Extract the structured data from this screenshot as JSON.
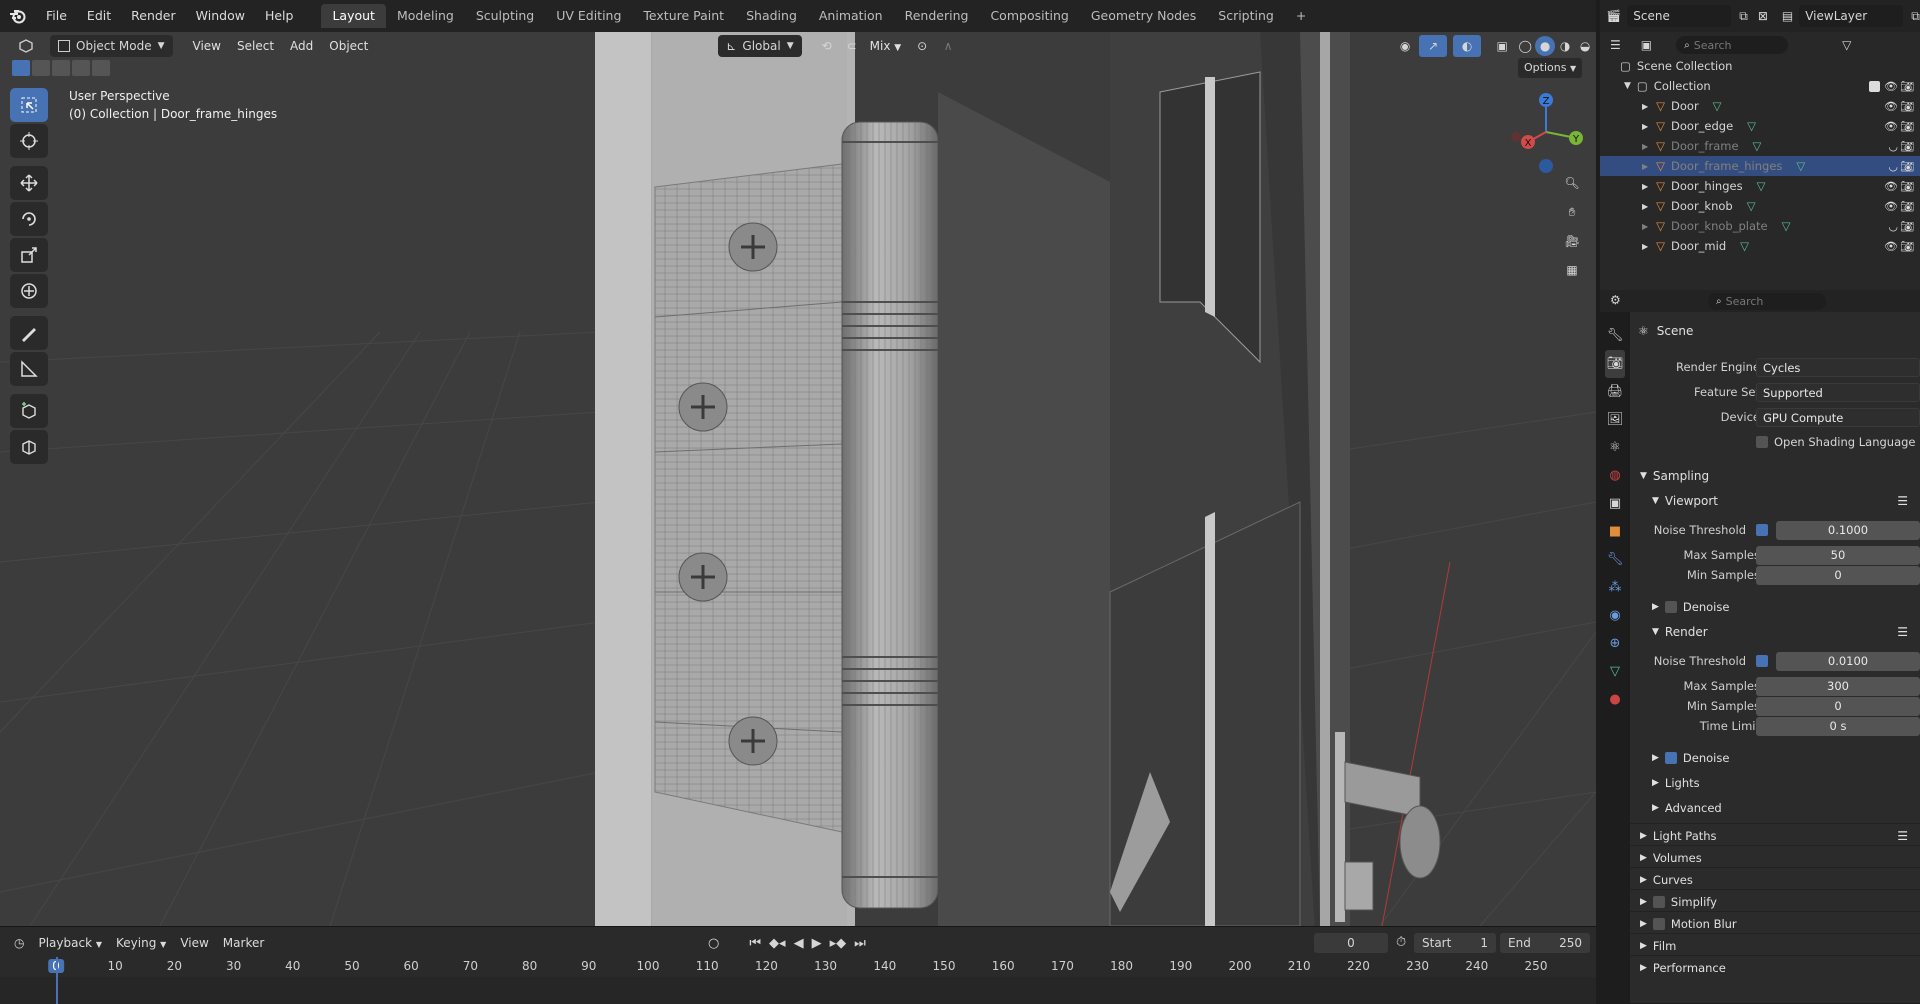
{
  "topbar": {
    "menus": [
      "File",
      "Edit",
      "Render",
      "Window",
      "Help"
    ],
    "workspaces": [
      "Layout",
      "Modeling",
      "Sculpting",
      "UV Editing",
      "Texture Paint",
      "Shading",
      "Animation",
      "Rendering",
      "Compositing",
      "Geometry Nodes",
      "Scripting",
      "+"
    ],
    "active_workspace": "Layout",
    "scene": "Scene",
    "view_layer": "ViewLayer"
  },
  "viewport": {
    "mode": "Object Mode",
    "menus": [
      "View",
      "Select",
      "Add",
      "Object"
    ],
    "orientation": "Global",
    "snap_mode": "Mix",
    "options": "Options",
    "perspective": "User Perspective",
    "context": "(0) Collection | Door_frame_hinges",
    "gizmo": {
      "x": "X",
      "y": "Y",
      "z": "Z"
    }
  },
  "timeline": {
    "menus": [
      "Playback",
      "Keying",
      "View",
      "Marker"
    ],
    "current_frame": "0",
    "start_label": "Start",
    "start": "1",
    "end_label": "End",
    "end": "250",
    "ticks": [
      "0",
      "10",
      "20",
      "30",
      "40",
      "50",
      "60",
      "70",
      "80",
      "90",
      "100",
      "110",
      "120",
      "130",
      "140",
      "150",
      "160",
      "170",
      "180",
      "190",
      "200",
      "210",
      "220",
      "230",
      "240",
      "250"
    ]
  },
  "outliner": {
    "search_placeholder": "Search",
    "root": "Scene Collection",
    "collection": "Collection",
    "items": [
      {
        "name": "Door",
        "state": "visible"
      },
      {
        "name": "Door_edge",
        "state": "visible"
      },
      {
        "name": "Door_frame",
        "state": "hidden"
      },
      {
        "name": "Door_frame_hinges",
        "state": "selected"
      },
      {
        "name": "Door_hinges",
        "state": "visible"
      },
      {
        "name": "Door_knob",
        "state": "visible"
      },
      {
        "name": "Door_knob_plate",
        "state": "hidden"
      },
      {
        "name": "Door_mid",
        "state": "visible"
      }
    ]
  },
  "properties": {
    "search_placeholder": "Search",
    "context": "Scene",
    "render_engine_label": "Render Engine",
    "render_engine": "Cycles",
    "feature_set_label": "Feature Set",
    "feature_set": "Supported",
    "device_label": "Device",
    "device": "GPU Compute",
    "osl_label": "Open Shading Language",
    "sampling": "Sampling",
    "viewport": {
      "title": "Viewport",
      "noise_threshold_label": "Noise Threshold",
      "noise_threshold": "0.1000",
      "max_samples_label": "Max Samples",
      "max_samples": "50",
      "min_samples_label": "Min Samples",
      "min_samples": "0",
      "denoise": "Denoise"
    },
    "render": {
      "title": "Render",
      "noise_threshold_label": "Noise Threshold",
      "noise_threshold": "0.0100",
      "max_samples_label": "Max Samples",
      "max_samples": "300",
      "min_samples_label": "Min Samples",
      "min_samples": "0",
      "time_limit_label": "Time Limit",
      "time_limit": "0 s",
      "denoise": "Denoise"
    },
    "sub_sections": [
      "Lights",
      "Advanced"
    ],
    "sections": [
      "Light Paths",
      "Volumes",
      "Curves",
      "Simplify",
      "Motion Blur",
      "Film",
      "Performance"
    ]
  },
  "colors": {
    "accent": "#4772b3",
    "selection": "#334d80",
    "object_orange": "#e08d3c",
    "mesh_green": "#5bbd8e"
  }
}
